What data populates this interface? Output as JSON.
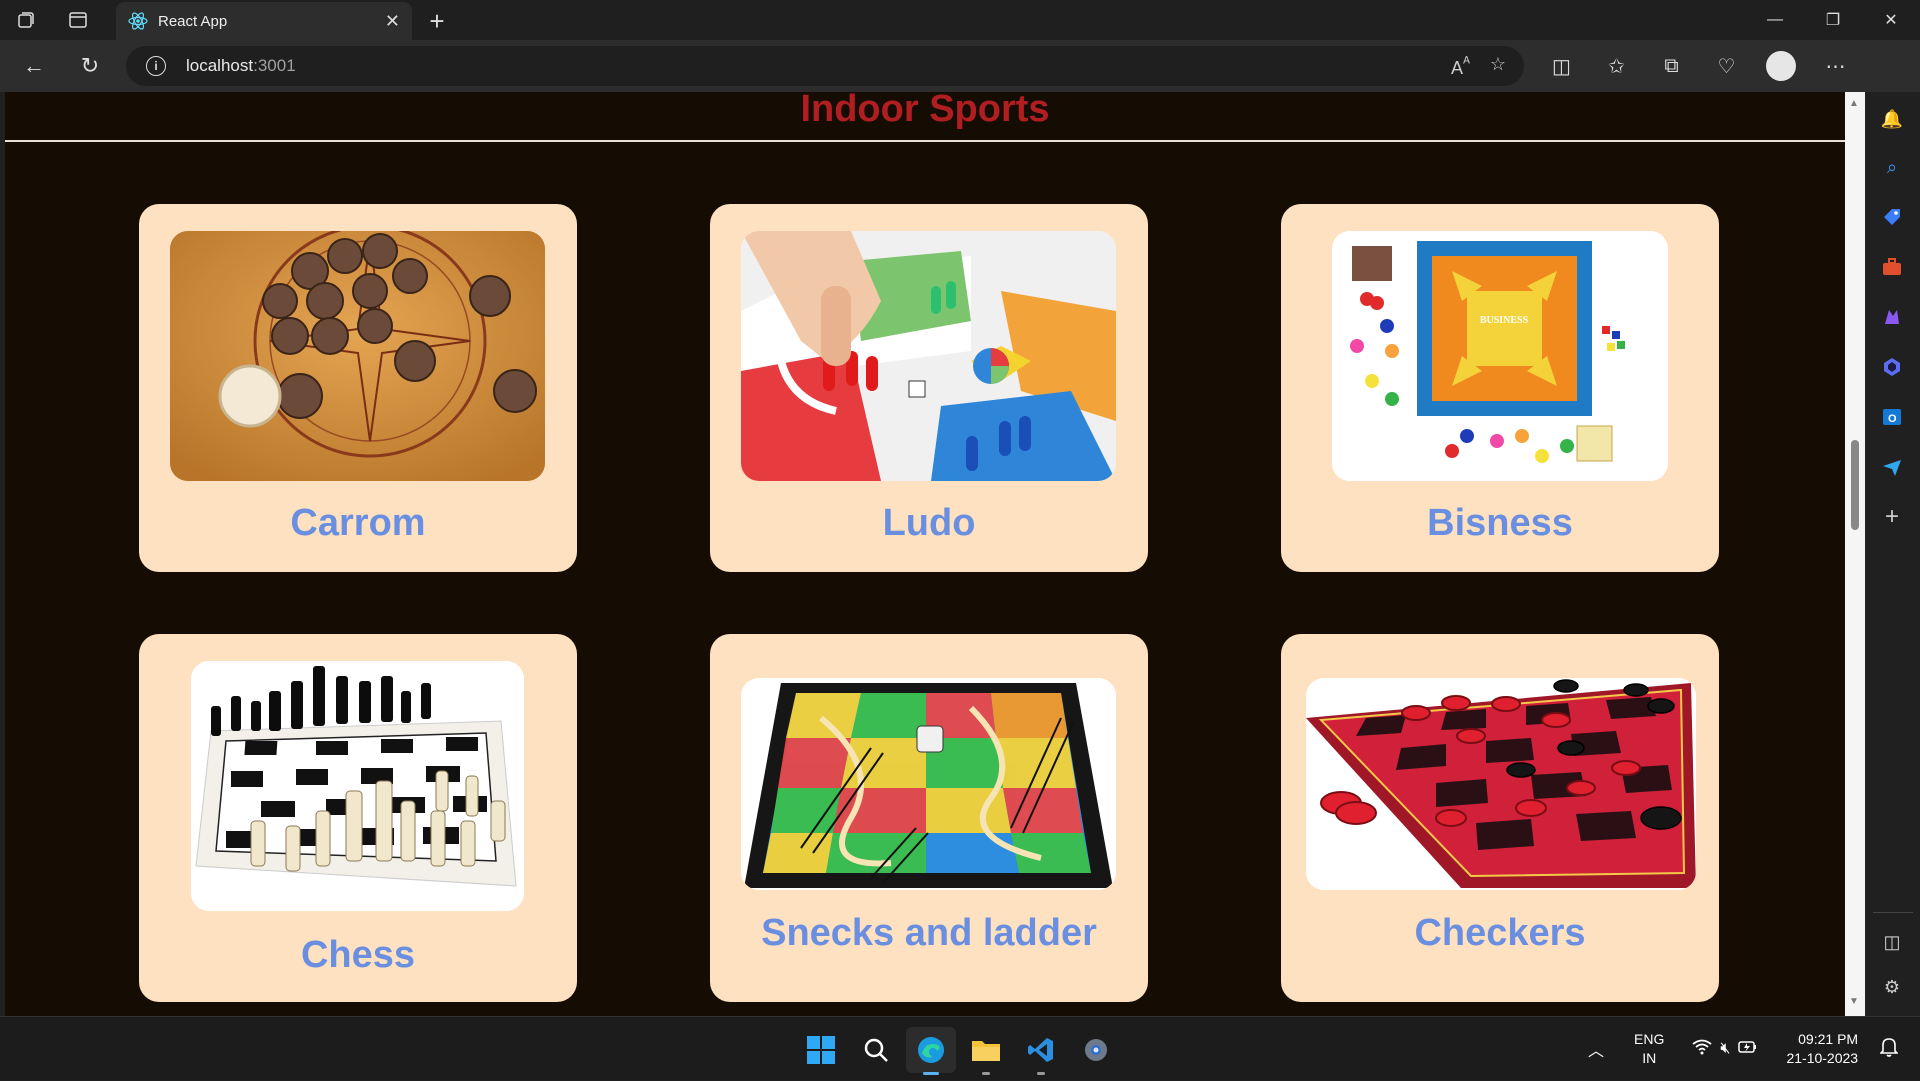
{
  "browser": {
    "tab_title": "React App",
    "address_host": "localhost",
    "address_port": ":3001"
  },
  "page": {
    "title": "Indoor Sports",
    "cards": [
      {
        "name": "Carrom"
      },
      {
        "name": "Ludo"
      },
      {
        "name": "Bisness",
        "board_text": "BUSINESS"
      },
      {
        "name": "Chess"
      },
      {
        "name": "Snecks and ladder"
      },
      {
        "name": "Checkers"
      }
    ]
  },
  "taskbar": {
    "lang_line1": "ENG",
    "lang_line2": "IN",
    "time": "09:21 PM",
    "date": "21-10-2023"
  },
  "colors": {
    "page_bg": "#150c03",
    "title": "#b01e22",
    "card_bg": "#fee1c1",
    "card_label": "#6b8fe0"
  }
}
